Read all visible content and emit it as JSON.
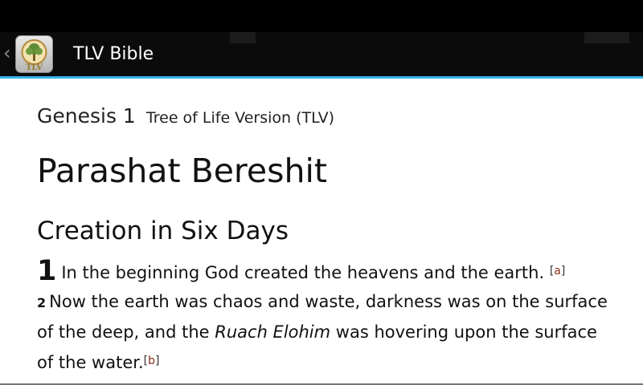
{
  "action_bar": {
    "title": "TLV Bible",
    "accent_color": "#33b5e5",
    "up_icon": "chevron-left-icon",
    "app_icon": "tree-of-life-logo",
    "app_icon_text": "TLV"
  },
  "reference": {
    "book_chapter": "Genesis 1",
    "version": "Tree of Life Version (TLV)"
  },
  "parashat_title": "Parashat Bereshit",
  "section_heading": "Creation in Six Days",
  "verses": {
    "v1": {
      "number": "1",
      "text": "In the beginning God created the heavens and the earth.",
      "footnote": "a"
    },
    "v2": {
      "number": "2",
      "text_before": "Now the earth was chaos and waste, darkness was on the surface of the deep, and the",
      "italic": "Ruach Elohim",
      "text_after": "was hovering upon the surface of the water.",
      "footnote": "b"
    }
  }
}
